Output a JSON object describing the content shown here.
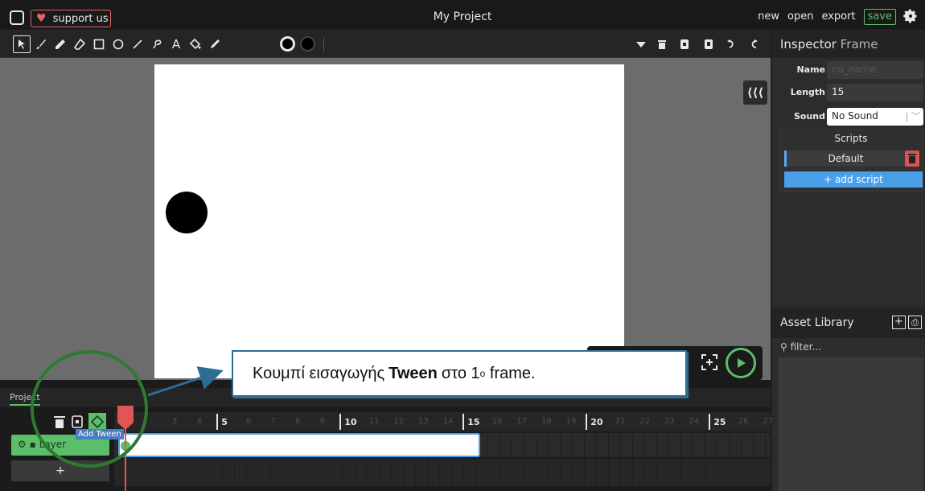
{
  "topbar": {
    "support_label": "support us",
    "project_title": "My Project",
    "menu": [
      "new",
      "open",
      "export"
    ],
    "save_label": "save"
  },
  "toolbar": {
    "tools": [
      "cursor-icon",
      "brush-icon",
      "pencil-icon",
      "eraser-icon",
      "rectangle-icon",
      "ellipse-icon",
      "line-icon",
      "lasso-icon",
      "text-icon",
      "fill-bucket-icon",
      "eyedropper-icon"
    ],
    "text_tool_glyph": "A",
    "actions": [
      "triangle-down-icon",
      "trash-icon",
      "copy-icon",
      "paste-icon",
      "undo-icon",
      "redo-icon"
    ]
  },
  "inspector": {
    "title": "Inspector",
    "subtitle": "Frame",
    "name_label": "Name",
    "name_placeholder": "no_name",
    "length_label": "Length",
    "length_value": "15",
    "sound_label": "Sound",
    "sound_value": "No Sound",
    "scripts_title": "Scripts",
    "default_script": "Default",
    "add_script": "+ add script"
  },
  "assets": {
    "title": "Asset Library",
    "add_glyph": "+",
    "filter_placeholder": "filter..."
  },
  "timeline": {
    "tab_label": "Project",
    "layer_name": "Layer",
    "tooltip": "Add Tween",
    "add_layer": "+",
    "frame_numbers": [
      "3",
      "4",
      "5",
      "6",
      "7",
      "8",
      "9",
      "10",
      "11",
      "12",
      "13",
      "14",
      "15",
      "16",
      "17",
      "18",
      "19",
      "20",
      "21",
      "22",
      "23",
      "24",
      "25",
      "26",
      "27"
    ]
  },
  "annotation": {
    "text_before": "Κουμπί εισαγωγής",
    "text_bold": "Tween",
    "text_after": "στο 1",
    "superscript": "ο",
    "text_end": "frame."
  },
  "colors": {
    "accent_green": "#5bbf6a",
    "accent_blue": "#4aa0e8",
    "danger_red": "#e05555"
  }
}
